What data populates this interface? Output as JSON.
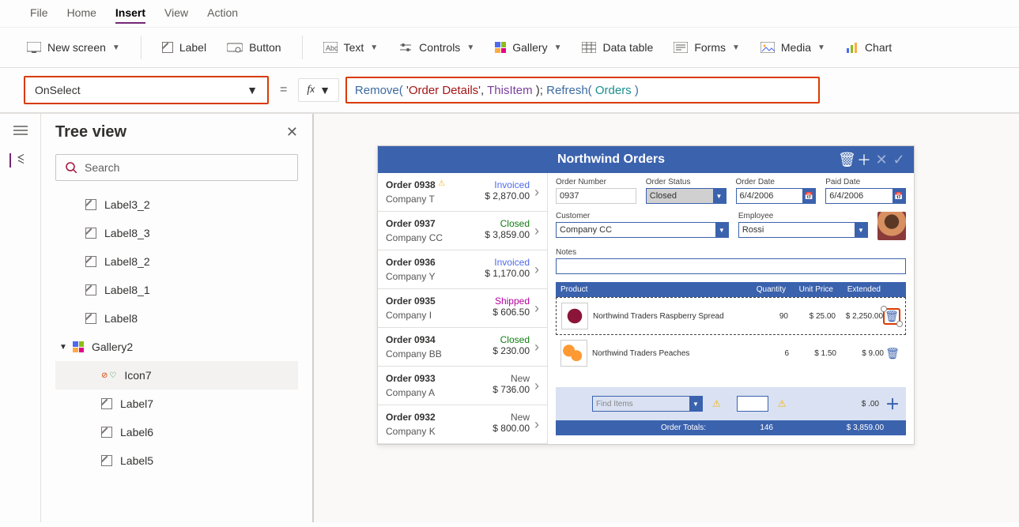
{
  "menu": {
    "file": "File",
    "home": "Home",
    "insert": "Insert",
    "view": "View",
    "action": "Action"
  },
  "toolbar": {
    "newScreen": "New screen",
    "label": "Label",
    "button": "Button",
    "text": "Text",
    "controls": "Controls",
    "gallery": "Gallery",
    "dataTable": "Data table",
    "forms": "Forms",
    "media": "Media",
    "chart": "Chart"
  },
  "property": {
    "name": "OnSelect"
  },
  "formula": {
    "fn1": "Remove",
    "p1": "( ",
    "str1": "'Order Details'",
    "c1": ", ",
    "id1": "ThisItem",
    "p2": " ); ",
    "fn2": "Refresh",
    "p3": "( ",
    "id2": "Orders",
    "p4": " )"
  },
  "tree": {
    "title": "Tree view",
    "search": "Search",
    "items": [
      {
        "label": "Label3_2",
        "type": "label"
      },
      {
        "label": "Label8_3",
        "type": "label"
      },
      {
        "label": "Label8_2",
        "type": "label"
      },
      {
        "label": "Label8_1",
        "type": "label"
      },
      {
        "label": "Label8",
        "type": "label"
      },
      {
        "label": "Gallery2",
        "type": "gallery"
      },
      {
        "label": "Icon7",
        "type": "icon",
        "selected": true
      },
      {
        "label": "Label7",
        "type": "label"
      },
      {
        "label": "Label6",
        "type": "label"
      },
      {
        "label": "Label5",
        "type": "label"
      }
    ]
  },
  "app": {
    "title": "Northwind Orders",
    "orders": [
      {
        "id": "Order 0938",
        "company": "Company T",
        "status": "Invoiced",
        "statusClass": "st-invoiced",
        "amount": "$ 2,870.00",
        "warn": true
      },
      {
        "id": "Order 0937",
        "company": "Company CC",
        "status": "Closed",
        "statusClass": "st-closed",
        "amount": "$ 3,859.00"
      },
      {
        "id": "Order 0936",
        "company": "Company Y",
        "status": "Invoiced",
        "statusClass": "st-invoiced",
        "amount": "$ 1,170.00"
      },
      {
        "id": "Order 0935",
        "company": "Company I",
        "status": "Shipped",
        "statusClass": "st-shipped",
        "amount": "$ 606.50"
      },
      {
        "id": "Order 0934",
        "company": "Company BB",
        "status": "Closed",
        "statusClass": "st-closed",
        "amount": "$ 230.00"
      },
      {
        "id": "Order 0933",
        "company": "Company A",
        "status": "New",
        "statusClass": "st-new",
        "amount": "$ 736.00"
      },
      {
        "id": "Order 0932",
        "company": "Company K",
        "status": "New",
        "statusClass": "st-new",
        "amount": "$ 800.00"
      }
    ],
    "form": {
      "orderNumLabel": "Order Number",
      "orderNum": "0937",
      "statusLabel": "Order Status",
      "status": "Closed",
      "orderDateLabel": "Order Date",
      "orderDate": "6/4/2006",
      "paidDateLabel": "Paid Date",
      "paidDate": "6/4/2006",
      "customerLabel": "Customer",
      "customer": "Company CC",
      "employeeLabel": "Employee",
      "employee": "Rossi",
      "notesLabel": "Notes"
    },
    "productHeaders": {
      "product": "Product",
      "qty": "Quantity",
      "unitPrice": "Unit Price",
      "extended": "Extended"
    },
    "products": [
      {
        "name": "Northwind Traders Raspberry Spread",
        "qty": "90",
        "unitPrice": "$ 25.00",
        "extended": "$ 2,250.00",
        "img": "raspberry",
        "selected": true
      },
      {
        "name": "Northwind Traders Peaches",
        "qty": "6",
        "unitPrice": "$ 1.50",
        "extended": "$ 9.00",
        "img": "peaches"
      }
    ],
    "addRow": {
      "placeholder": "Find Items",
      "extended": "$ .00"
    },
    "totals": {
      "label": "Order Totals:",
      "qty": "146",
      "total": "$ 3,859.00"
    }
  }
}
